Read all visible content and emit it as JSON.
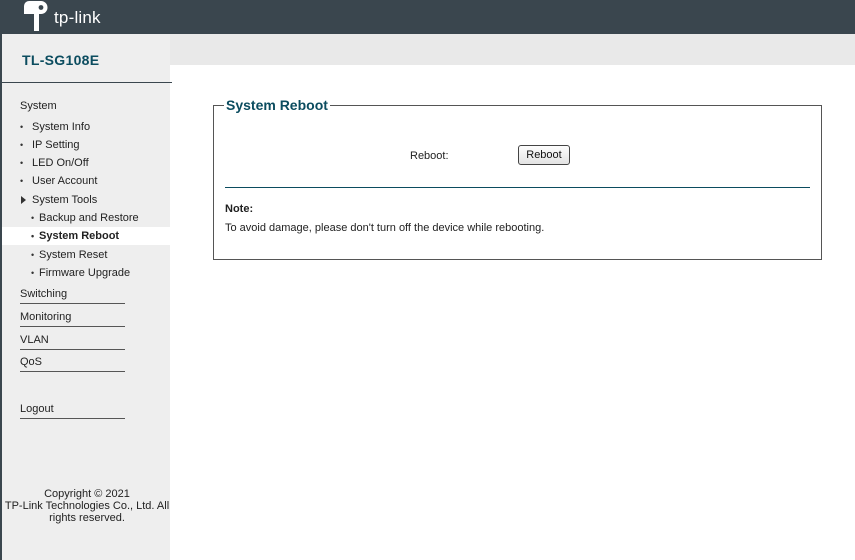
{
  "header": {
    "logo_text": "tp-link",
    "logo_icon": "tp-link-logo-icon"
  },
  "sidebar": {
    "model": "TL-SG108E",
    "system_heading": "System",
    "items": [
      {
        "label": "System Info"
      },
      {
        "label": "IP Setting"
      },
      {
        "label": "LED On/Off"
      },
      {
        "label": "User Account"
      },
      {
        "label": "System Tools"
      }
    ],
    "tools_items": [
      {
        "label": "Backup and Restore"
      },
      {
        "label": "System Reboot"
      },
      {
        "label": "System Reset"
      },
      {
        "label": "Firmware Upgrade"
      }
    ],
    "sections": [
      {
        "label": "Switching"
      },
      {
        "label": "Monitoring"
      },
      {
        "label": "VLAN"
      },
      {
        "label": "QoS"
      }
    ],
    "logout": "Logout",
    "copyright_line1": "Copyright © 2021",
    "copyright_line2": "TP-Link Technologies Co., Ltd. All",
    "copyright_line3": "rights reserved.",
    "active_item": "System Reboot",
    "bullet": "•"
  },
  "main": {
    "panel_title": "System Reboot",
    "reboot_label": "Reboot:",
    "reboot_button": "Reboot",
    "note_title": "Note:",
    "note_text": "To avoid damage, please don't turn off the device while rebooting."
  },
  "colors": {
    "header_bg": "#3a464e",
    "accent": "#0b4c5f",
    "sidebar_bg": "#eeeeee"
  }
}
